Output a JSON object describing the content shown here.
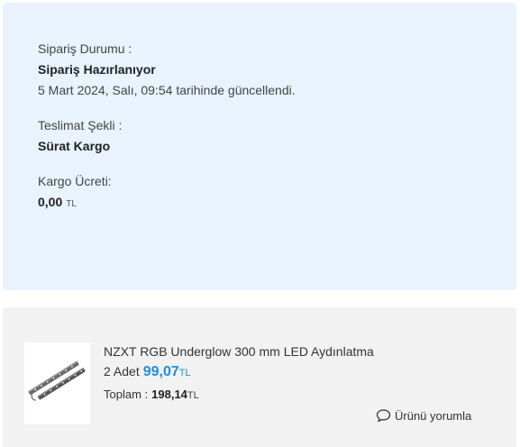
{
  "order_status": {
    "status_label": "Sipariş Durumu :",
    "status_value": "Sipariş Hazırlanıyor",
    "updated_text": "5 Mart 2024, Salı, 09:54 tarihinde güncellendi.",
    "delivery_label": "Teslimat Şekli :",
    "delivery_value": "Sürat Kargo",
    "shipping_fee_label": "Kargo Ücreti:",
    "shipping_fee_value": "0,00",
    "shipping_fee_currency": "TL"
  },
  "product": {
    "name": "NZXT RGB Underglow 300 mm LED Aydınlatma",
    "quantity_text": "2 Adet",
    "unit_price": "99,07",
    "unit_price_currency": "TL",
    "total_label": "Toplam :",
    "total_value": "198,14",
    "total_currency": "TL",
    "comment_label": "Ürünü yorumla",
    "comment_icon": "speech-bubble-icon",
    "image_icon": "led-strip-image"
  },
  "colors": {
    "status_bg": "#e8f3fd",
    "product_bg": "#f2f2f2",
    "price_accent": "#1f8fe6"
  }
}
